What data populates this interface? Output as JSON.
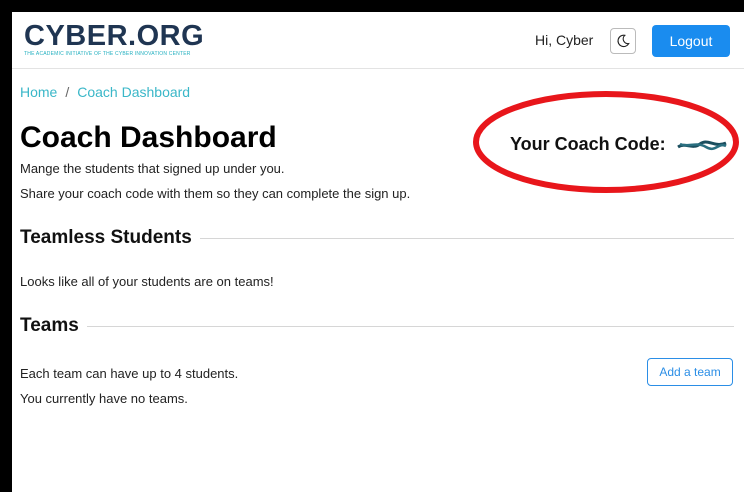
{
  "header": {
    "logo_text": "CYBER.ORG",
    "logo_tagline": "THE ACADEMIC INITIATIVE OF THE CYBER INNOVATION CENTER",
    "greeting": "Hi, Cyber",
    "theme_icon": "moon-icon",
    "logout_label": "Logout"
  },
  "breadcrumb": {
    "items": [
      "Home",
      "Coach Dashboard"
    ],
    "separator": "/"
  },
  "page": {
    "title": "Coach Dashboard",
    "description_line1": "Mange the students that signed up under you.",
    "description_line2": "Share your coach code with them so they can complete the sign up.",
    "coach_code_label": "Your Coach Code:",
    "coach_code_value": "redacted"
  },
  "teamless": {
    "heading": "Teamless Students",
    "message": "Looks like all of your students are on teams!"
  },
  "teams": {
    "heading": "Teams",
    "limit_note": "Each team can have up to 4 students.",
    "empty_note": "You currently have no teams.",
    "add_label": "Add a team"
  },
  "colors": {
    "primary": "#1a8cef",
    "link": "#3ab7c8",
    "annotation": "#e8161b",
    "logo": "#1f3552"
  }
}
